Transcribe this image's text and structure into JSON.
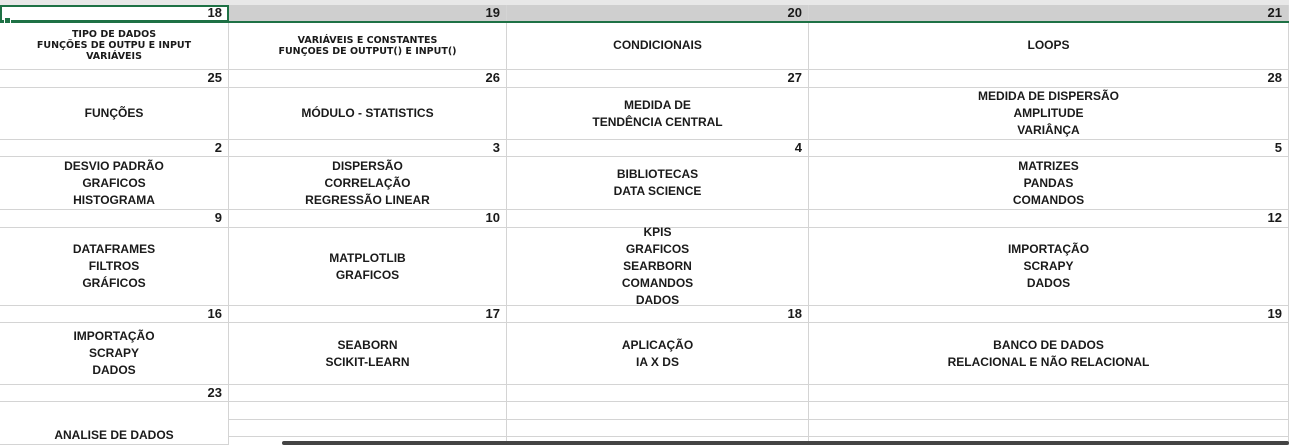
{
  "weeks": [
    {
      "days": [
        "18",
        "19",
        "20",
        "21"
      ],
      "topics": [
        [
          "TIPO DE DADOS",
          "FUNÇÕES DE OUTPU E INPUT",
          "VARIÁVEIS"
        ],
        [
          "VARIÁVEIS E CONSTANTES",
          "FUNÇOES DE OUTPUT() E INPUT()"
        ],
        [
          "CONDICIONAIS"
        ],
        [
          "LOOPS"
        ]
      ]
    },
    {
      "days": [
        "25",
        "26",
        "27",
        "28"
      ],
      "topics": [
        [
          "FUNÇÕES"
        ],
        [
          "MÓDULO - STATISTICS"
        ],
        [
          "MEDIDA DE",
          "TENDÊNCIA CENTRAL"
        ],
        [
          "MEDIDA DE DISPERSÃO",
          "AMPLITUDE",
          "VARIÂNÇA"
        ]
      ]
    },
    {
      "days": [
        "2",
        "3",
        "4",
        "5"
      ],
      "topics": [
        [
          "DESVIO PADRÃO",
          "GRAFICOS",
          "HISTOGRAMA"
        ],
        [
          "DISPERSÃO",
          "CORRELAÇÃO",
          "REGRESSÃO LINEAR"
        ],
        [
          "BIBLIOTECAS",
          "DATA SCIENCE"
        ],
        [
          "MATRIZES",
          "PANDAS",
          "COMANDOS"
        ]
      ]
    },
    {
      "days": [
        "9",
        "10",
        "",
        "12"
      ],
      "topics": [
        [
          "DATAFRAMES",
          "FILTROS",
          "GRÁFICOS"
        ],
        [
          "MATPLOTLIB",
          "GRAFICOS"
        ],
        [
          "KPIS",
          "GRAFICOS",
          "SEARBORN",
          "COMANDOS",
          "DADOS"
        ],
        [
          "IMPORTAÇÃO",
          "SCRAPY",
          "DADOS"
        ]
      ]
    },
    {
      "days": [
        "16",
        "17",
        "18",
        "19"
      ],
      "topics": [
        [
          "IMPORTAÇÃO",
          "SCRAPY",
          "DADOS"
        ],
        [
          "SEABORN",
          "SCIKIT-LEARN"
        ],
        [
          "APLICAÇÃO",
          "IA X DS"
        ],
        [
          "BANCO DE DADOS",
          "RELACIONAL E NÃO RELACIONAL"
        ]
      ]
    },
    {
      "days": [
        "23",
        "",
        "",
        ""
      ],
      "topics": [
        [
          "ANALISE DE DADOS"
        ],
        [],
        [],
        []
      ]
    }
  ]
}
